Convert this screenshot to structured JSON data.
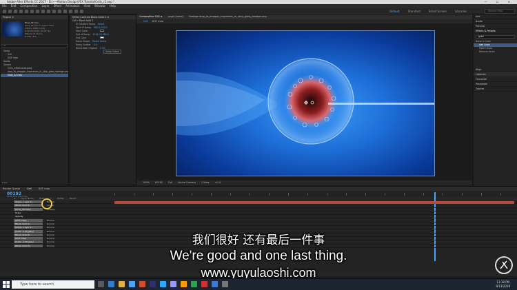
{
  "window": {
    "title": "Adobe After Effects CC 2017 - D:\\~~Motion Design\\VFX Tutorial\\Cells_r2.aep *",
    "controls": "— ☐ ✕"
  },
  "menu": [
    "File",
    "Edit",
    "Composition",
    "Layer",
    "Effect",
    "Animation",
    "View",
    "Window",
    "Help"
  ],
  "workspaces": {
    "items": [
      "Default",
      "Standard",
      "Small Screen",
      "Libraries"
    ],
    "active": "Default",
    "search_placeholder": "Search Help"
  },
  "project_panel": {
    "tab": "Project ≡",
    "selected_name": "Drop_32.mov",
    "info_lines": [
      "Drop_32.mov ▾, used 1 time",
      "1920 x 1080 (1.00)",
      "Δ 00;00;10;00, 29.97 fps",
      "Millions of Colors",
      "H.264 / Pro..."
    ],
    "search_placeholder": "ρ▾",
    "items": [
      "Comp",
      "Cell",
      "DOF map",
      "Solids",
      "Source",
      "Cells_29000.0.00.jpeg",
      "drop_to_dropper_inspiration_in_ultra_glass_footage.png",
      "Drop_32.mov"
    ],
    "footer": "8 bpc"
  },
  "effect_controls": {
    "tab": "Effect Controls Black Solid 2 ≡",
    "header": "Cell • Black Solid 2",
    "rows": [
      {
        "label": "fx  Gradient Ramp",
        "value": "Reset"
      },
      {
        "label": "Start of Ramp",
        "value": "960.0,540.0"
      },
      {
        "label": "Start Color",
        "value": ""
      },
      {
        "label": "End of Ramp",
        "value": "1344.0,1080.0"
      },
      {
        "label": "End Color",
        "value": ""
      },
      {
        "label": "Ramp Shape",
        "value": "Radial Ramp"
      },
      {
        "label": "Ramp Scatter",
        "value": "0.0"
      },
      {
        "label": "Blend With Original",
        "value": "0.0%"
      },
      {
        "label": "",
        "value": "Swap Colors"
      }
    ]
  },
  "composition": {
    "tabs": [
      "Composition Cell ≡",
      "Layer (none)",
      "Footage drop_to_dropper_inspiration_in_ultra_glass_footage.png"
    ],
    "sub_tabs": [
      "Cell",
      "DOF map"
    ],
    "zoom": "100%",
    "timecode": "00192",
    "resolution": "Full",
    "camera": "Active Camera",
    "views": "1 View",
    "exposure": "+0.0"
  },
  "right_panel": {
    "items": [
      "Info",
      "Audio",
      "Preview",
      "Effects & Presets"
    ],
    "search_value": "grain",
    "fx_group": "Noise & Grain",
    "fx_items": [
      "Add Grain",
      "Match Grain",
      "Remove Grain"
    ],
    "more": [
      "Align",
      "Libraries",
      "Character",
      "Paragraph",
      "Tracker"
    ]
  },
  "timeline": {
    "tabs": [
      "Render Queue",
      "Cell",
      "DOF map"
    ],
    "timecode": "00192",
    "fps_info": "00:00:06:12 (29.97 fps)",
    "column_headers": [
      "#",
      "Layer Name",
      "Mode",
      "T",
      "TrkMat",
      "Parent"
    ],
    "layers": [
      {
        "name": "[Adjus...Layer 2]",
        "mode": "Normal"
      },
      {
        "name": "[Black Solid 2]",
        "mode": "Screen"
      },
      {
        "name": "[Drop_32.mov]",
        "mode": "Multiply"
      },
      {
        "name": "Scale",
        "mode": ""
      },
      {
        "name": "Opacity",
        "mode": ""
      },
      {
        "name": "[DOF map]",
        "mode": "Normal"
      },
      {
        "name": "[Black Solid 1]",
        "mode": "Normal"
      },
      {
        "name": "[Adjus...Layer 1]",
        "mode": "Normal"
      },
      {
        "name": "[Cells...0.00.jpeg]",
        "mode": "Normal"
      },
      {
        "name": "[Black Solid 3]",
        "mode": "Normal"
      },
      {
        "name": "[DOF map]",
        "mode": "Normal"
      },
      {
        "name": "[Cells...0.00.jpeg]",
        "mode": "Normal"
      },
      {
        "name": "[Black Solid 3]",
        "mode": "Normal"
      }
    ],
    "footer": "Toggle Switches / Modes"
  },
  "subtitles": {
    "chinese": "我们很好 还有最后一件事",
    "english": "We're good and one last thing.",
    "url": "www.yuyulaoshi.com"
  },
  "taskbar": {
    "search_placeholder": "Type here to search",
    "time": "11:18 PM",
    "date": "8/13/2018"
  },
  "colors": {
    "accent": "#4aa3ff",
    "layer_green": "#7fa36a",
    "layer_red": "#b6493b",
    "layer_lavender": "#8f93c9"
  }
}
